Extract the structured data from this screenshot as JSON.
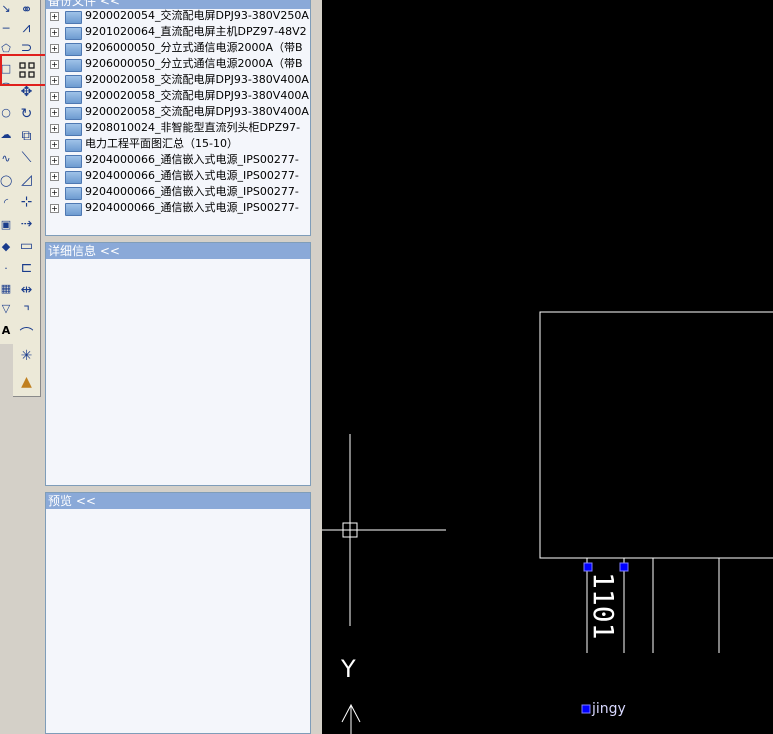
{
  "tree_panel": {
    "header": "备份文件 <<",
    "items": [
      {
        "label": "9200020054_交流配电屏DPJ93-380V250A"
      },
      {
        "label": "9201020064_直流配电屏主机DPZ97-48V2"
      },
      {
        "label": "9206000050_分立式通信电源2000A（带B"
      },
      {
        "label": "9206000050_分立式通信电源2000A（带B"
      },
      {
        "label": "9200020058_交流配电屏DPJ93-380V400A"
      },
      {
        "label": "9200020058_交流配电屏DPJ93-380V400A"
      },
      {
        "label": "9200020058_交流配电屏DPJ93-380V400A"
      },
      {
        "label": "9208010024_非智能型直流列头柜DPZ97-"
      },
      {
        "label": "电力工程平面图汇总（15-10）"
      },
      {
        "label": "9204000066_通信嵌入式电源_IPS00277-"
      },
      {
        "label": "9204000066_通信嵌入式电源_IPS00277-"
      },
      {
        "label": "9204000066_通信嵌入式电源_IPS00277-"
      },
      {
        "label": "9204000066_通信嵌入式电源_IPS00277-"
      }
    ]
  },
  "detail_panel": {
    "header": "详细信息 <<"
  },
  "preview_panel": {
    "header": "预览 <<"
  },
  "drawing": {
    "text_vertical": "1101",
    "text_user": "jingy",
    "ucs_y_label": "Y"
  },
  "colors": {
    "canvas_bg": "#000000",
    "line": "#ffffff",
    "grip": "#0000ff",
    "highlight": "#e0201c"
  }
}
